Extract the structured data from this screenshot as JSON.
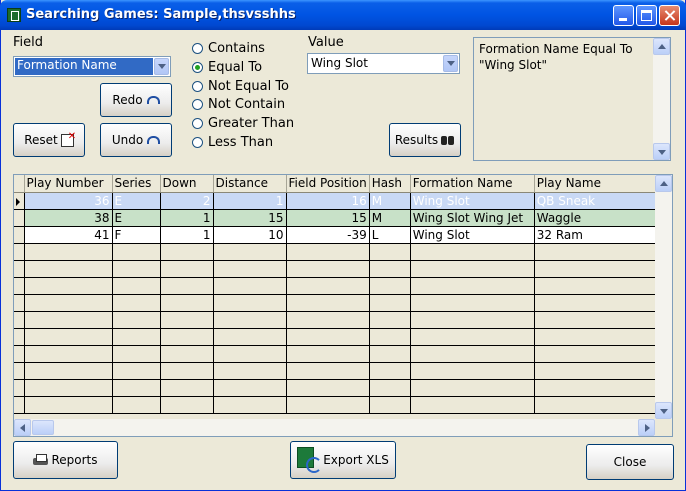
{
  "window": {
    "title": "Searching Games: Sample,thsvsshhs"
  },
  "field": {
    "label": "Field",
    "selected": "Formation Name"
  },
  "value": {
    "label": "Value",
    "selected": "Wing Slot"
  },
  "operators": {
    "options": [
      "Contains",
      "Equal To",
      "Not Equal To",
      "Not Contain",
      "Greater Than",
      "Less Than"
    ],
    "selected": "Equal To"
  },
  "buttons": {
    "redo": "Redo",
    "undo": "Undo",
    "reset": "Reset",
    "results": "Results",
    "reports": "Reports",
    "export": "Export XLS",
    "close": "Close"
  },
  "criteria": {
    "text": "Formation Name Equal To \"Wing Slot\""
  },
  "grid": {
    "columns": [
      "Play Number",
      "Series",
      "Down",
      "Distance",
      "Field Position",
      "Hash",
      "Formation Name",
      "Play Name"
    ],
    "rows": [
      [
        "36",
        "E",
        "2",
        "1",
        "16",
        "M",
        "Wing Slot",
        "QB Sneak"
      ],
      [
        "38",
        "E",
        "1",
        "15",
        "15",
        "M",
        "Wing Slot Wing Jet",
        "Waggle"
      ],
      [
        "41",
        "F",
        "1",
        "10",
        "-39",
        "L",
        "Wing Slot",
        "32 Ram"
      ]
    ],
    "selected_row": 0
  },
  "colors": {
    "title_bar": "#0054e3",
    "selected_row": "#c9d9f5",
    "alt_row": "#c8e1c8"
  }
}
